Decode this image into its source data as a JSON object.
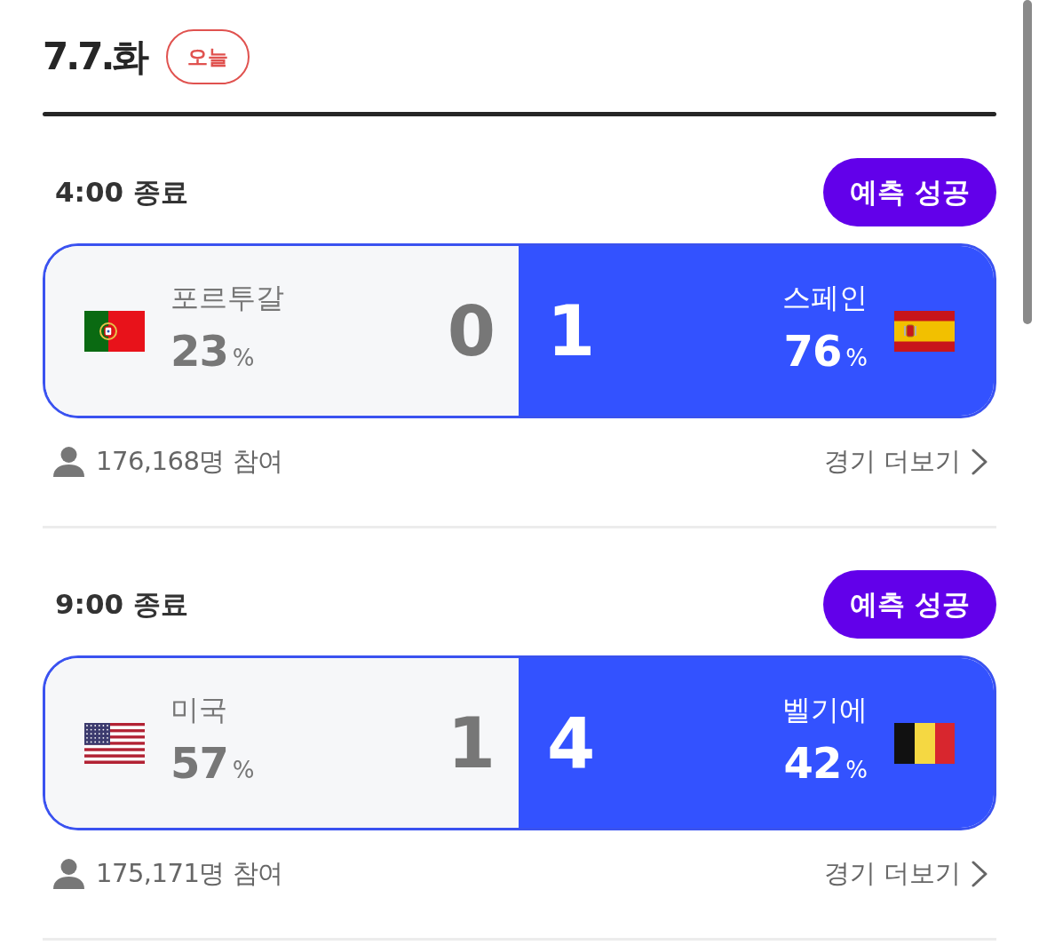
{
  "date_header": {
    "date": "7.7.화",
    "today_badge": "오늘"
  },
  "matches": [
    {
      "time_status": "4:00 종료",
      "result_badge": "예측 성공",
      "teams": [
        {
          "name": "포르투갈",
          "kind": "portugal",
          "percent": "23",
          "unit": "%",
          "score": "0",
          "winner": false
        },
        {
          "name": "스페인",
          "kind": "spain",
          "percent": "76",
          "unit": "%",
          "score": "1",
          "winner": true
        }
      ],
      "participants": "176,168명 참여",
      "more_link": "경기 더보기"
    },
    {
      "time_status": "9:00 종료",
      "result_badge": "예측 성공",
      "teams": [
        {
          "name": "미국",
          "kind": "usa",
          "percent": "57",
          "unit": "%",
          "score": "1",
          "winner": false
        },
        {
          "name": "벨기에",
          "kind": "belgium",
          "percent": "42",
          "unit": "%",
          "score": "4",
          "winner": true
        }
      ],
      "participants": "175,171명 참여",
      "more_link": "경기 더보기"
    }
  ]
}
